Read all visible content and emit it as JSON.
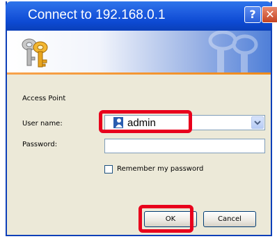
{
  "window": {
    "title": "Connect to 192.168.0.1",
    "help_label": "?",
    "close_label": "✕"
  },
  "dialog": {
    "realm_label": "Access Point",
    "username_label": "User name:",
    "username_value": "admin",
    "password_label": "Password:",
    "password_value": "",
    "remember_label": "Remember my password",
    "remember_checked": false,
    "ok_label": "OK",
    "cancel_label": "Cancel"
  },
  "icons": {
    "dialog_icon": "keys-icon",
    "user": "user-icon",
    "dropdown": "chevron-down-icon"
  },
  "colors": {
    "titlebar": "#0d4ad3",
    "window_bg": "#ece9d8",
    "accent_line": "#f08b1a",
    "highlight": "#e8001c"
  }
}
